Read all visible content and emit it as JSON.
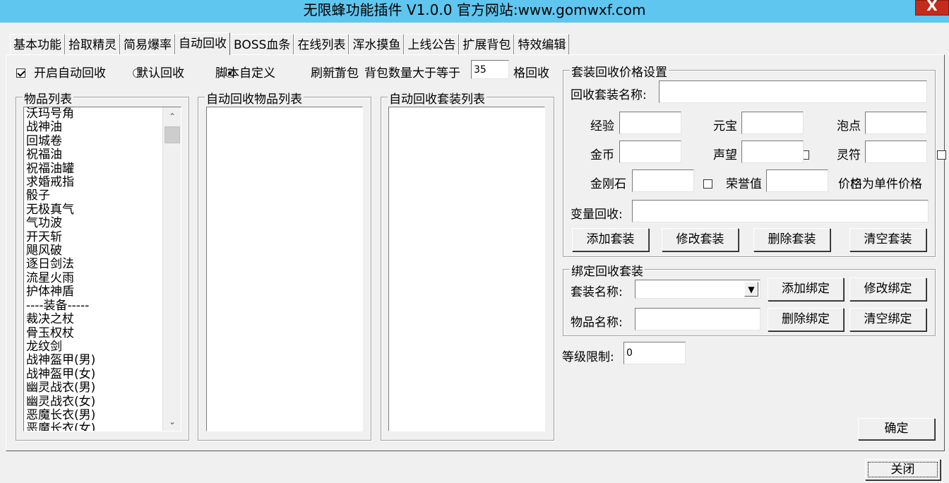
{
  "window": {
    "title": "无限蜂功能插件 V1.0.0  官方网站:www.gomwxf.com",
    "close_label": "X"
  },
  "tabs": [
    {
      "label": "基本功能"
    },
    {
      "label": "拾取精灵"
    },
    {
      "label": "简易爆率"
    },
    {
      "label": "自动回收"
    },
    {
      "label": "BOSS血条"
    },
    {
      "label": "在线列表"
    },
    {
      "label": "浑水摸鱼"
    },
    {
      "label": "上线公告"
    },
    {
      "label": "扩展背包"
    },
    {
      "label": "特效编辑"
    }
  ],
  "active_tab": "自动回收",
  "options": {
    "auto_recycle": {
      "label": "开启自动回收",
      "checked": true
    },
    "default_recycle": {
      "label": "默认回收",
      "selected": false
    },
    "script_custom": {
      "label": "脚本自定义",
      "selected": true
    },
    "refresh_bag": {
      "label": "刷新背包",
      "checked": false
    },
    "bag_count_label": "背包数量大于等于",
    "bag_count_value": "35",
    "bag_count_suffix": "格回收"
  },
  "item_list": {
    "title": "物品列表",
    "items": [
      "沃玛号角",
      "战神油",
      "回城卷",
      "祝福油",
      "祝福油罐",
      "求婚戒指",
      "骰子",
      "无极真气",
      "气功波",
      "开天斩",
      "飓风破",
      "逐日剑法",
      "流星火雨",
      "护体神盾",
      "----装备-----",
      "裁决之杖",
      "骨玉权杖",
      "龙纹剑",
      "战神盔甲(男)",
      "战神盔甲(女)",
      "幽灵战衣(男)",
      "幽灵战衣(女)",
      "恶魔长衣(男)",
      "恶魔长衣(女)"
    ]
  },
  "recycle_item_list": {
    "title": "自动回收物品列表"
  },
  "recycle_suit_list": {
    "title": "自动回收套装列表"
  },
  "suit_price": {
    "title": "套装回收价格设置",
    "name_label": "回收套装名称:",
    "name_value": "",
    "exp": {
      "label": "经验",
      "value": ""
    },
    "yuanbao": {
      "label": "元宝",
      "value": ""
    },
    "paodian": {
      "label": "泡点",
      "value": ""
    },
    "gold": {
      "label": "金币",
      "value": ""
    },
    "prestige": {
      "label": "声望",
      "value": ""
    },
    "lingfu": {
      "label": "灵符",
      "value": ""
    },
    "diamond": {
      "label": "金刚石",
      "value": ""
    },
    "honor": {
      "label": "荣誉值",
      "value": ""
    },
    "unit_price_note": "价格为单件价格",
    "var_label": "变量回收:",
    "var_value": "",
    "btn_add": "添加套装",
    "btn_edit": "修改套装",
    "btn_delete": "删除套装",
    "btn_clear": "清空套装"
  },
  "bind_suit": {
    "title": "绑定回收套装",
    "suit_name_label": "套装名称:",
    "suit_name_value": "",
    "item_name_label": "物品名称:",
    "item_name_value": "",
    "btn_add": "添加绑定",
    "btn_edit": "修改绑定",
    "btn_delete": "删除绑定",
    "btn_clear": "清空绑定"
  },
  "level_limit": {
    "label": "等级限制:",
    "value": "0"
  },
  "confirm_label": "确定",
  "close_window_label": "关闭"
}
